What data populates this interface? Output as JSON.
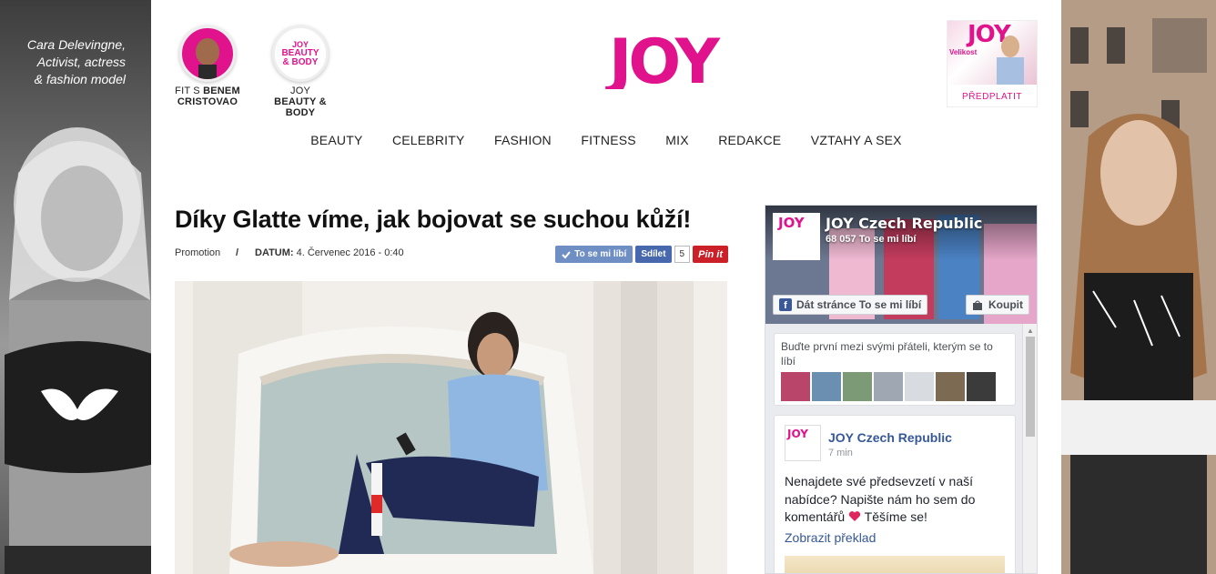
{
  "ad_left": {
    "tagline_lines": [
      "Cara Delevingne,",
      "Activist, actress",
      "& fashion model"
    ]
  },
  "header": {
    "feature_1": {
      "line1": "FIT S ",
      "line1_bold": "BENEM",
      "line2": "CRISTOVAO"
    },
    "feature_2": {
      "icon_text_1": "JOY",
      "icon_text_2": "BEAUTY",
      "icon_text_3": "& BODY",
      "line1": "JOY",
      "line2": "BEAUTY & BODY"
    },
    "logo": "JOY",
    "magazine": {
      "cover_logo": "JOY",
      "cover_text": "Velikost",
      "subscribe_label": "PŘEDPLATIT"
    }
  },
  "nav": {
    "items": [
      "BEAUTY",
      "CELEBRITY",
      "FASHION",
      "FITNESS",
      "MIX",
      "REDAKCE",
      "VZTAHY A SEX"
    ]
  },
  "article": {
    "title": "Díky Glatte víme, jak bojovat se suchou kůží!",
    "category": "Promotion",
    "separator": "/",
    "date_label": "DATUM:",
    "date_value": " 4. Červenec 2016 - 0:40",
    "share": {
      "like_label": "To se mi líbí",
      "share_label": "Sdílet",
      "share_count": "5",
      "pin_label": "Pin it"
    }
  },
  "facebook": {
    "page_name": "JOY Czech Republic",
    "likes": "68 057 To se mi líbí",
    "like_page_label": "Dát stránce To se mi líbí",
    "buy_label": "Koupit",
    "friends_text": "Buďte první mezi svými přáteli, kterým se to líbí",
    "post": {
      "author": "JOY Czech Republic",
      "time": "7 min",
      "text_1": "Nenajdete své předsevzetí v naší nabídce? Napište nám ho sem do komentářů ",
      "text_2": " Těšíme se!",
      "translate": "Zobrazit překlad"
    },
    "colors": {
      "link": "#365899",
      "brand": "#3b5998"
    }
  },
  "colors": {
    "brand": "#e0138c",
    "pinterest": "#cb2027"
  }
}
